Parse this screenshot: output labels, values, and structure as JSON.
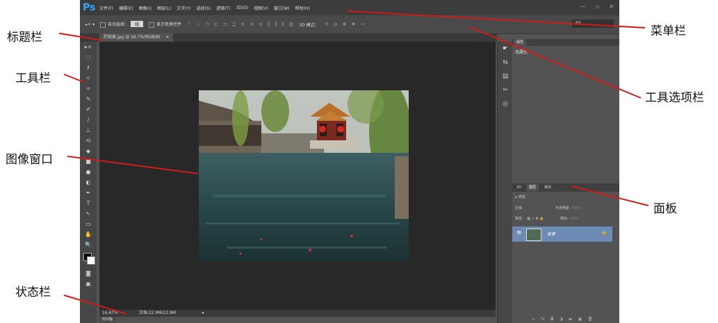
{
  "app": {
    "logo": "Ps"
  },
  "menu": [
    "文件(F)",
    "编辑(E)",
    "图像(I)",
    "图层(L)",
    "文字(Y)",
    "选择(S)",
    "滤镜(T)",
    "3D(D)",
    "视图(V)",
    "窗口(W)",
    "帮助(H)"
  ],
  "window_buttons": {
    "minimize": "—",
    "restore": "▫",
    "close": "✕"
  },
  "options": {
    "tool_glyph": "▸+ ▾",
    "auto_select_label": "自动选择：",
    "auto_select_value": "组",
    "show_transform_label": "显示变换控件",
    "mode3d_label": "3D 模式：",
    "workspace": "3D"
  },
  "document_tab": {
    "title": "趵突泉.jpg @ 16.7%(RGB/8)",
    "close": "×"
  },
  "status": {
    "zoom": "16.67%",
    "doc_size": "文档:22.9M/22.9M",
    "arrow": "▸"
  },
  "timeline_tab": "时间轴",
  "panels": {
    "properties_tab": "属性",
    "properties_body": "无属性",
    "layers_tabs": [
      "3D",
      "图层",
      "通道"
    ],
    "filter_label": "ρ 类型",
    "blend_mode": "正常",
    "opacity_label": "不透明度:",
    "opacity_value": "100%",
    "lock_label": "锁定:",
    "fill_label": "填充:",
    "fill_value": "100%",
    "layer_name": "背景"
  },
  "tools": [
    "▸+",
    "⬚",
    "ℓ",
    "⊹",
    "⌗",
    "✎",
    "✐",
    "/",
    "⊥",
    "⟲",
    "◆",
    "■",
    "●",
    "◐",
    "✒",
    "T",
    "↖",
    "▭",
    "✋",
    "🔍"
  ],
  "strip_icons": [
    "☛",
    "⇆",
    "▤",
    "✂",
    "◎"
  ],
  "callouts": {
    "title_bar": "标题栏",
    "toolbar": "工具栏",
    "image_window": "图像窗口",
    "status_bar": "状态栏",
    "menu_bar": "菜单栏",
    "options_bar": "工具选项栏",
    "panel": "面板"
  }
}
